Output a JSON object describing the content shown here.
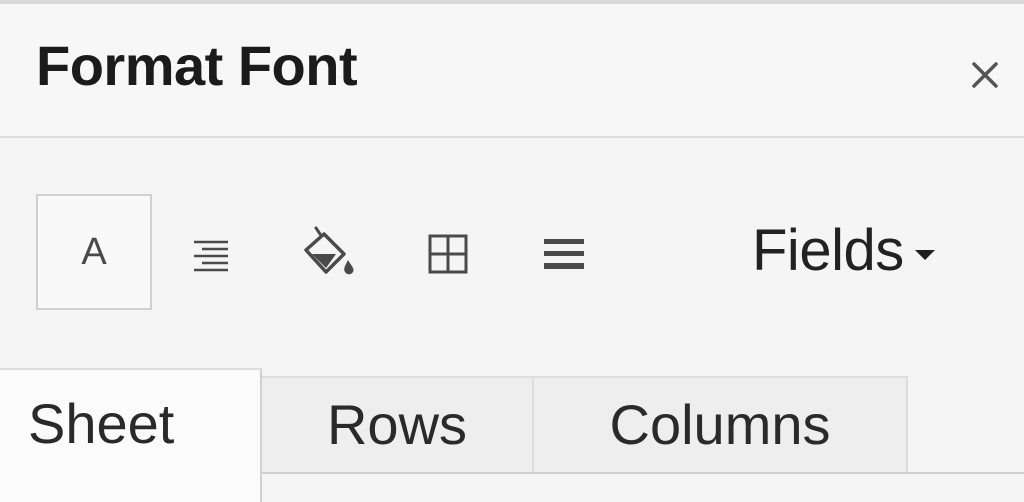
{
  "panel": {
    "title": "Format Font"
  },
  "toolbar": {
    "tools": [
      {
        "icon": "font-a-icon",
        "glyph": "A",
        "active": true
      },
      {
        "icon": "align-right-icon",
        "active": false
      },
      {
        "icon": "paint-bucket-icon",
        "active": false
      },
      {
        "icon": "borders-grid-icon",
        "active": false
      },
      {
        "icon": "lines-icon",
        "active": false
      }
    ],
    "scope_dropdown": {
      "label": "Fields"
    }
  },
  "tabs": [
    {
      "label": "Sheet",
      "active": true
    },
    {
      "label": "Rows",
      "active": false
    },
    {
      "label": "Columns",
      "active": false
    }
  ],
  "colors": {
    "background": "#f5f5f5",
    "text": "#1b1b1b",
    "icon": "#4a4a4a",
    "border": "#d0d0d0"
  }
}
